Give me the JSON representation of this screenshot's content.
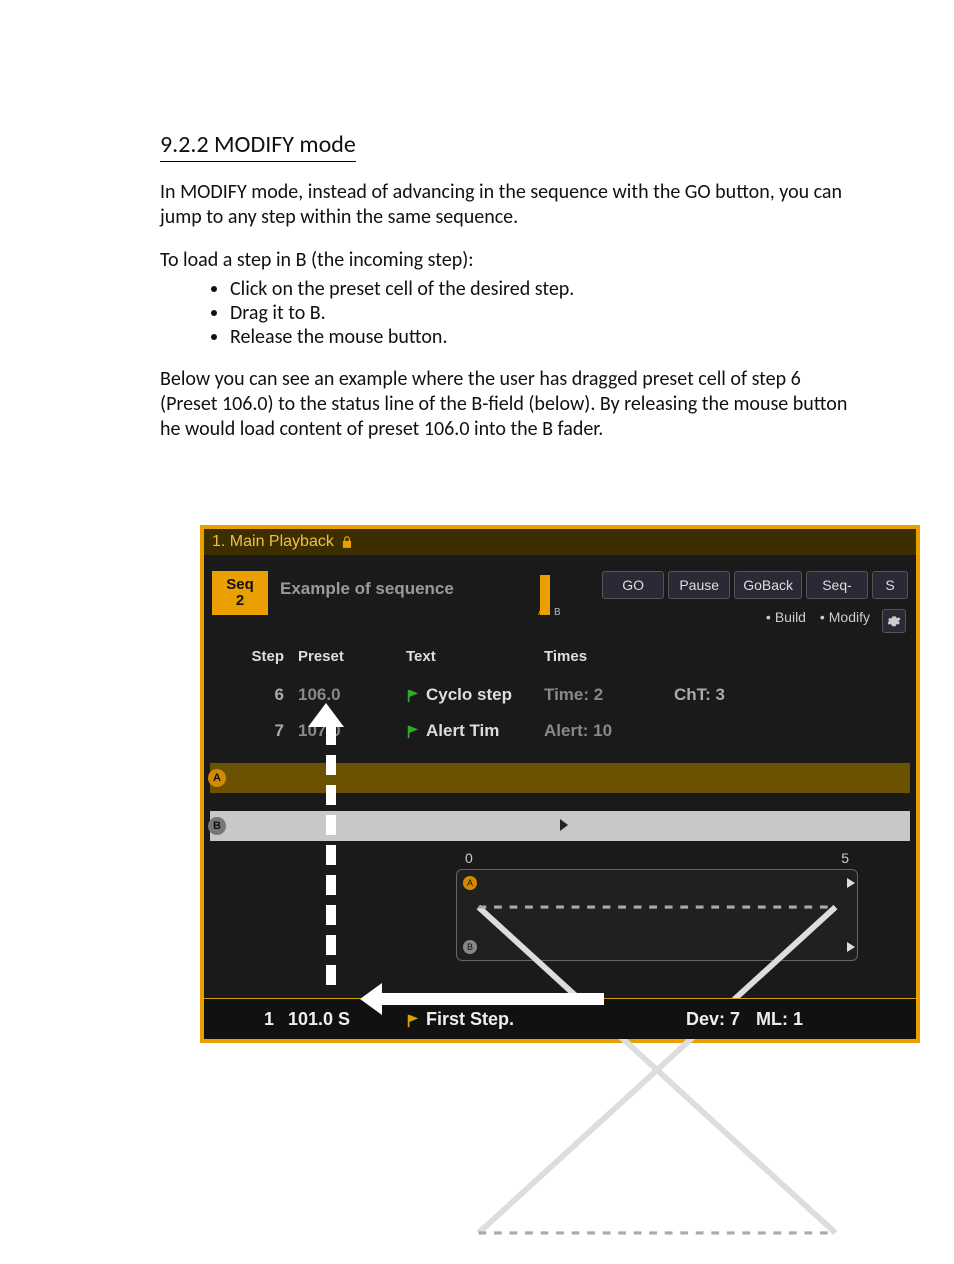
{
  "doc": {
    "heading": "9.2.2   MODIFY mode",
    "p1": "In MODIFY mode, instead of advancing in the sequence with the GO button, you can jump to any step within the same sequence.",
    "intro": "To load a step in B (the incoming step):",
    "steps": [
      "Click on the preset cell of the desired step.",
      "Drag it to B.",
      "Release the mouse button."
    ],
    "p2": "Below you can see an example where the user has dragged preset cell of step 6 (Preset 106.0) to the status line of the B-field (below). By releasing the mouse button he would load content of preset 106.0 into the B fader."
  },
  "panel": {
    "title": "1. Main Playback",
    "seq": {
      "label": "Seq",
      "num": "2",
      "name": "Example of sequence"
    },
    "ab": {
      "a": "A",
      "b": "B"
    },
    "buttons": [
      "GO",
      "Pause",
      "GoBack",
      "Seq-",
      "S"
    ],
    "subopts": {
      "build": "Build",
      "modify": "Modify"
    },
    "columns": {
      "step": "Step",
      "preset": "Preset",
      "text": "Text",
      "times": "Times"
    },
    "rows": [
      {
        "step": "6",
        "preset": "106.0",
        "text": "Cyclo step",
        "times": "Time: 2",
        "extra": "ChT: 3"
      },
      {
        "step": "7",
        "preset": "107.0",
        "text": "Alert Tim",
        "times": "Alert: 10",
        "extra": ""
      }
    ],
    "lanes": {
      "a": "A",
      "b": "B"
    },
    "chart_data": {
      "type": "line",
      "title": "",
      "xlabel": "",
      "ylabel": "",
      "xlim": [
        0,
        5
      ],
      "tick_labels": {
        "left": "0",
        "right": "5"
      },
      "series": [
        {
          "name": "A",
          "x": [
            0,
            5
          ],
          "y": [
            1,
            0
          ]
        },
        {
          "name": "B",
          "x": [
            0,
            5
          ],
          "y": [
            0,
            1
          ]
        }
      ]
    },
    "status": {
      "step": "1",
      "preset": "101.0 S",
      "text": "First Step.",
      "dev": "Dev: 7",
      "ml": "ML: 1"
    }
  }
}
